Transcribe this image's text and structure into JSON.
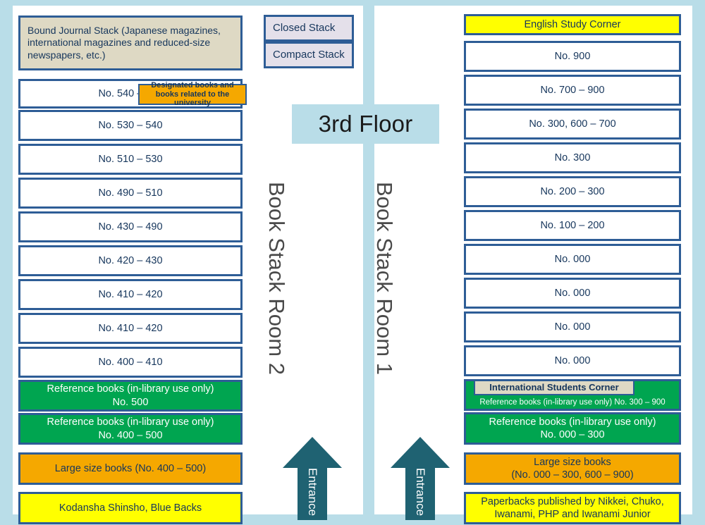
{
  "floor": {
    "banner_label": "3rd Floor"
  },
  "legend": {
    "items": [
      {
        "label": "Closed Stack",
        "color": "#e4e0ea"
      },
      {
        "label": "Compact Stack",
        "color": "#e4e0ea"
      }
    ]
  },
  "rooms": [
    {
      "label": "Book Stack Room 2"
    },
    {
      "label": "Book Stack Room 1"
    }
  ],
  "entrances": [
    {
      "label": "Entrance"
    },
    {
      "label": "Entrance"
    }
  ],
  "left_column": {
    "shelves": [
      {
        "label": "Bound Journal Stack (Japanese magazines, international magazines and reduced-size newspapers, etc.)",
        "style": "tan"
      },
      {
        "label": "No. 540 – 590",
        "style": "white",
        "tag": "Designated books and books related to the university",
        "tag_style": "orange"
      },
      {
        "label": "No. 530 – 540",
        "style": "white"
      },
      {
        "label": "No. 510 – 530",
        "style": "white"
      },
      {
        "label": "No. 490 – 510",
        "style": "white"
      },
      {
        "label": "No. 430 – 490",
        "style": "white"
      },
      {
        "label": "No. 420 – 430",
        "style": "white"
      },
      {
        "label": "No. 410 – 420",
        "style": "white"
      },
      {
        "label": "No. 410 – 420",
        "style": "white"
      },
      {
        "label": "No. 400 – 410",
        "style": "white"
      },
      {
        "label": "Reference books (in-library use only)\nNo. 500",
        "style": "green"
      },
      {
        "label": "Reference books (in-library use only)\nNo. 400 – 500",
        "style": "green"
      },
      {
        "label": "Large size books (No. 400 – 500)",
        "style": "orange"
      },
      {
        "label": "Kodansha Shinsho, Blue Backs",
        "style": "yellow"
      }
    ]
  },
  "right_column": {
    "shelves": [
      {
        "label": "English Study Corner",
        "style": "yellow"
      },
      {
        "label": "No. 900",
        "style": "white"
      },
      {
        "label": "No. 700 – 900",
        "style": "white"
      },
      {
        "label": "No. 300, 600 – 700",
        "style": "white"
      },
      {
        "label": "No. 300",
        "style": "white"
      },
      {
        "label": "No. 200 – 300",
        "style": "white"
      },
      {
        "label": "No. 100 – 200",
        "style": "white"
      },
      {
        "label": "No. 000",
        "style": "white"
      },
      {
        "label": "No. 000",
        "style": "white"
      },
      {
        "label": "No. 000",
        "style": "white"
      },
      {
        "label": "No. 000",
        "style": "white"
      },
      {
        "label": "Reference books (in-library use only) No. 300 – 900",
        "style": "green",
        "tag": "International Students Corner",
        "tag_style": "tan"
      },
      {
        "label": "Reference books (in-library use only)\nNo. 000 – 300",
        "style": "green"
      },
      {
        "label": "Large size books\n(No. 000 – 300, 600 – 900)",
        "style": "orange"
      },
      {
        "label": "Paperbacks published by Nikkei, Chuko, Iwanami, PHP and Iwanami Junior",
        "style": "yellow"
      }
    ]
  },
  "colors": {
    "frame": "#b9dde8",
    "box_border": "#2e5d96",
    "text_navy": "#16365c",
    "tan": "#ded9c4",
    "green": "#00a550",
    "orange": "#f5a800",
    "yellow": "#ffff00",
    "lilac": "#e4e0ea",
    "arrow": "#1f6272"
  }
}
